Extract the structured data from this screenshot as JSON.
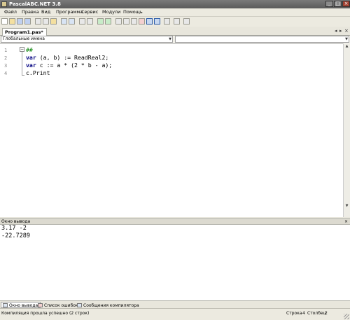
{
  "window": {
    "title": "PascalABC.NET 3.8"
  },
  "menu": [
    {
      "label": "Файл"
    },
    {
      "label": "Правка"
    },
    {
      "label": "Вид"
    },
    {
      "label": "Программа"
    },
    {
      "label": "Сервис"
    },
    {
      "label": "Модули"
    },
    {
      "label": "Помощь"
    }
  ],
  "tabs": [
    {
      "label": "Program1.pas*"
    }
  ],
  "scope_selector": {
    "value": "Глобальные имена"
  },
  "member_selector": {
    "value": ""
  },
  "editor": {
    "line_numbers": [
      "1",
      "2",
      "3",
      "4"
    ],
    "lines": [
      {
        "prefix": "",
        "keyword": "",
        "text": "##"
      },
      {
        "prefix": "",
        "keyword": "var",
        "text": " (a, b) := ReadReal2;"
      },
      {
        "prefix": "",
        "keyword": "var",
        "text": " c := a * (2 * b - a);"
      },
      {
        "prefix": "",
        "keyword": "",
        "text": "c.Print"
      }
    ]
  },
  "output_panel": {
    "title": "Окно вывода",
    "lines": [
      "3.17 -2",
      "-22.7289"
    ]
  },
  "bottom_tabs": [
    {
      "label": "Окно вывода"
    },
    {
      "label": "Список ошибок"
    },
    {
      "label": "Сообщения компилятора"
    }
  ],
  "status": {
    "message": "Компиляция прошла успешно (2 строк)",
    "row_label": "Строка",
    "row_value": "4",
    "col_label": "Столбец",
    "col_value": "2"
  }
}
